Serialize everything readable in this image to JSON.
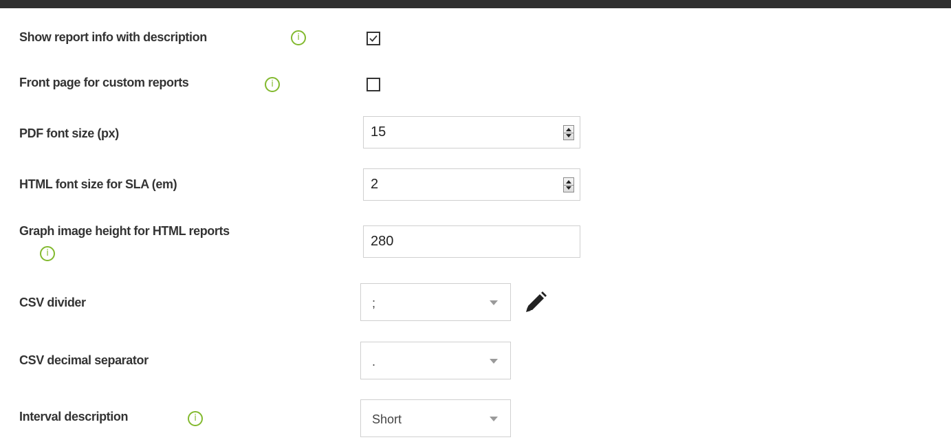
{
  "header": {
    "title": ""
  },
  "form": {
    "show_report_info": {
      "label": "Show report info with description",
      "checked": true,
      "info_icon": "info-icon"
    },
    "front_page_custom": {
      "label": "Front page for custom reports",
      "checked": false,
      "info_icon": "info-icon"
    },
    "pdf_font_size": {
      "label": "PDF font size (px)",
      "value": "15"
    },
    "html_font_size_sla": {
      "label": "HTML font size for SLA (em)",
      "value": "2"
    },
    "graph_image_height": {
      "label": "Graph image height for HTML reports",
      "value": "280",
      "info_icon": "info-icon"
    },
    "csv_divider": {
      "label": "CSV divider",
      "selected": ";",
      "edit_icon": "pencil-icon"
    },
    "csv_decimal_separator": {
      "label": "CSV decimal separator",
      "selected": "."
    },
    "interval_description": {
      "label": "Interval description",
      "selected": "Short",
      "info_icon": "info-icon"
    }
  },
  "colors": {
    "header_bg": "#2f2f2f",
    "info_icon": "#82b92e",
    "label_text": "#333333",
    "input_border": "#cfcfcf"
  }
}
